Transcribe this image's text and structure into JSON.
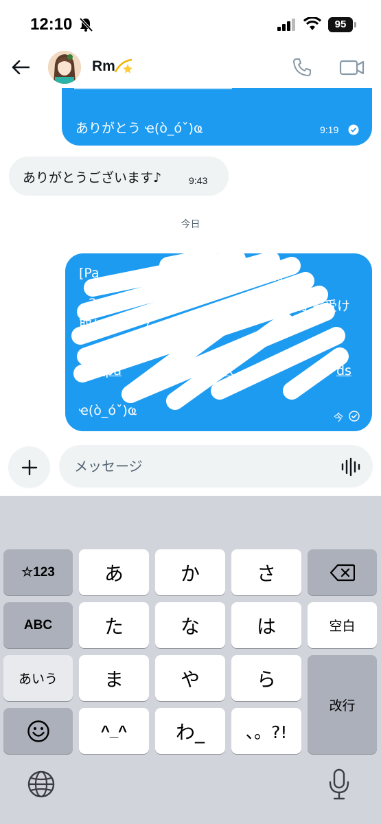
{
  "status_bar": {
    "time": "12:10",
    "battery": "95"
  },
  "header": {
    "contact_name": "Rm"
  },
  "messages": {
    "outgoing_top": {
      "text": "ありがとう ҽ(ò_óˇ)ҩ",
      "time": "9:19"
    },
    "incoming": {
      "text": "ありがとうございます♪",
      "time": "9:43"
    },
    "day_divider": "今日",
    "outgoing_big": {
      "lines": [
        "[Pa",
        "た。",
        "26/0",
        "から受け",
        "取り",
        "て",
        "pay.pa",
        "N3X",
        "ds",
        "ҽ(ò_óˇ)ҩ"
      ],
      "time": "今"
    }
  },
  "composer": {
    "placeholder": "メッセージ"
  },
  "keyboard": {
    "rows": [
      [
        "☆123",
        "あ",
        "か",
        "さ"
      ],
      [
        "ABC",
        "た",
        "な",
        "は",
        "空白"
      ],
      [
        "あいう",
        "ま",
        "や",
        "ら",
        "改行"
      ],
      [
        "^_^",
        "わ_",
        "、。?!"
      ]
    ]
  }
}
